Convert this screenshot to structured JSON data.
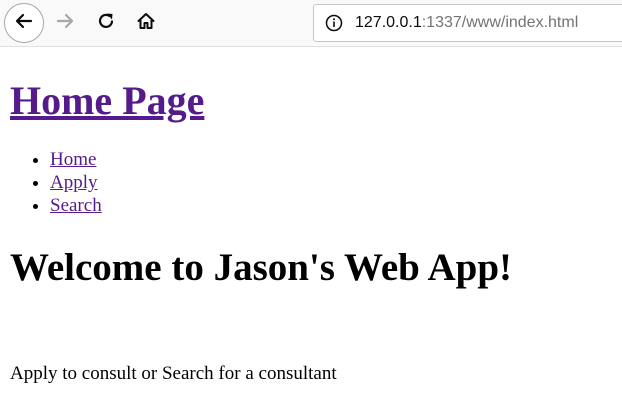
{
  "browser": {
    "toolbar": {
      "back_icon": "arrow-left-icon",
      "forward_icon": "arrow-right-icon",
      "reload_icon": "reload-icon",
      "home_icon": "home-icon"
    },
    "urlbar": {
      "info_icon": "info-icon",
      "host": "127.0.0.1",
      "rest": ":1337/www/index.html"
    }
  },
  "page": {
    "title": "Home Page",
    "nav": [
      {
        "label": "Home"
      },
      {
        "label": "Apply"
      },
      {
        "label": "Search"
      }
    ],
    "welcome": "Welcome to Jason's Web App!",
    "tagline": "Apply to consult or Search for a consultant",
    "link_color": "#551a8b"
  }
}
